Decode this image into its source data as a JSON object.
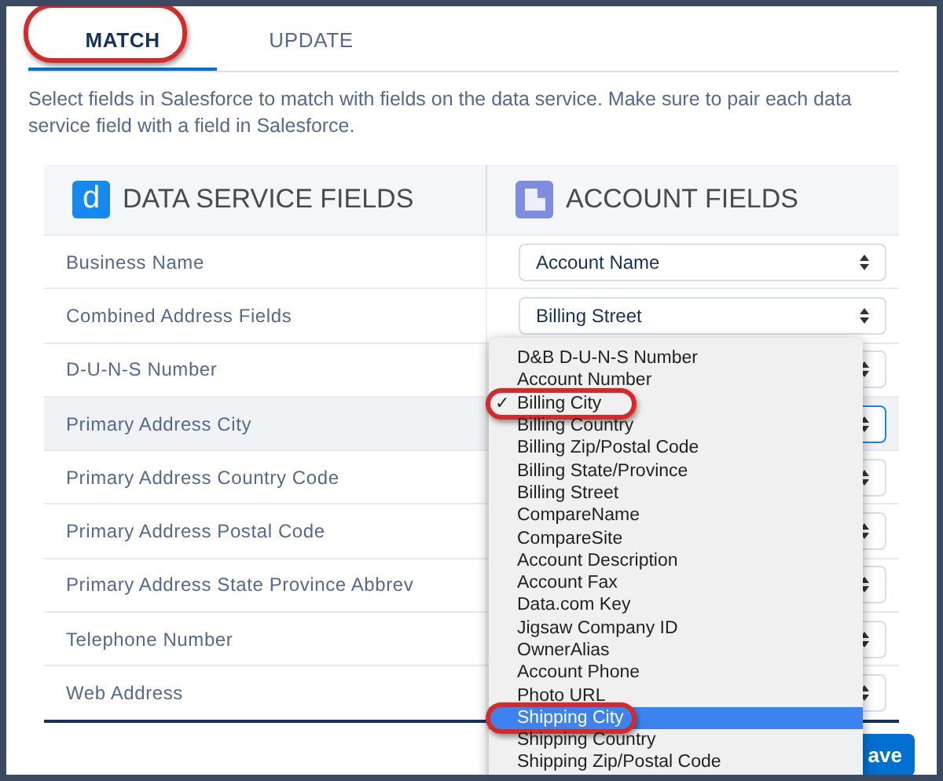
{
  "tabs": [
    {
      "label": "MATCH",
      "selected": true
    },
    {
      "label": "UPDATE",
      "selected": false
    }
  ],
  "description": "Select fields in Salesforce to match with fields on the data service. Make sure to pair each data service field with a field in Salesforce.",
  "columns": [
    {
      "label": "DATA SERVICE FIELDS",
      "icon_letter": "d"
    },
    {
      "label": "ACCOUNT FIELDS"
    }
  ],
  "rows": [
    {
      "field": "Business Name",
      "value": "Account Name",
      "selected": false
    },
    {
      "field": "Combined Address Fields",
      "value": "Billing Street",
      "selected": false
    },
    {
      "field": "D-U-N-S Number",
      "selected": false
    },
    {
      "field": "Primary Address City",
      "selected": true
    },
    {
      "field": "Primary Address Country Code",
      "selected": false
    },
    {
      "field": "Primary Address Postal Code",
      "selected": false
    },
    {
      "field": "Primary Address State Province Abbrev",
      "selected": false
    },
    {
      "field": "Telephone Number",
      "selected": false
    },
    {
      "field": "Web Address",
      "selected": false
    }
  ],
  "dropdown": [
    {
      "label": "D&B D-U-N-S Number",
      "selected": false,
      "highlighted": false
    },
    {
      "label": "Account Number",
      "selected": false,
      "highlighted": false
    },
    {
      "label": "Billing City",
      "selected": true,
      "highlighted": false
    },
    {
      "label": "Billing Country",
      "selected": false,
      "highlighted": false
    },
    {
      "label": "Billing Zip/Postal Code",
      "selected": false,
      "highlighted": false
    },
    {
      "label": "Billing State/Province",
      "selected": false,
      "highlighted": false
    },
    {
      "label": "Billing Street",
      "selected": false,
      "highlighted": false
    },
    {
      "label": "CompareName",
      "selected": false,
      "highlighted": false
    },
    {
      "label": "CompareSite",
      "selected": false,
      "highlighted": false
    },
    {
      "label": "Account Description",
      "selected": false,
      "highlighted": false
    },
    {
      "label": "Account Fax",
      "selected": false,
      "highlighted": false
    },
    {
      "label": "Data.com Key",
      "selected": false,
      "highlighted": false
    },
    {
      "label": "Jigsaw Company ID",
      "selected": false,
      "highlighted": false
    },
    {
      "label": "OwnerAlias",
      "selected": false,
      "highlighted": false
    },
    {
      "label": "Account Phone",
      "selected": false,
      "highlighted": false
    },
    {
      "label": "Photo URL",
      "selected": false,
      "highlighted": false
    },
    {
      "label": "Shipping City",
      "selected": false,
      "highlighted": true
    },
    {
      "label": "Shipping Country",
      "selected": false,
      "highlighted": false
    },
    {
      "label": "Shipping Zip/Postal Code",
      "selected": false,
      "highlighted": false
    }
  ],
  "check_mark": "✓",
  "save_button": "ave"
}
